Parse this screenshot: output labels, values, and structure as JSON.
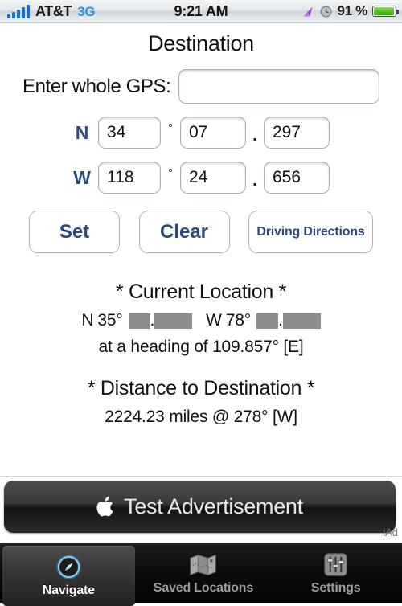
{
  "status_bar": {
    "signal_icon": "signal-bars-icon",
    "carrier": "AT&T",
    "network": "3G",
    "time": "9:21 AM",
    "location_icon": "location-arrow-icon",
    "alarm_icon": "clock-icon",
    "battery_percent": "91 %",
    "battery_icon": "battery-icon",
    "battery_level": 91,
    "accent_blue": "#2e90e8",
    "battery_green": "#51c01c",
    "location_purple": "#a13fd6"
  },
  "main": {
    "title": "Destination",
    "whole_gps": {
      "label": "Enter whole GPS:",
      "value": "",
      "placeholder": ""
    },
    "coordinates": [
      {
        "hemisphere": "N",
        "degrees": "34",
        "degree_symbol": "°",
        "minutes": "07",
        "decimal_point": ".",
        "fraction": "297"
      },
      {
        "hemisphere": "W",
        "degrees": "118",
        "degree_symbol": "°",
        "minutes": "24",
        "decimal_point": ".",
        "fraction": "656"
      }
    ],
    "buttons": {
      "set": "Set",
      "clear": "Clear",
      "driving_directions": "Driving Directions"
    },
    "label_navy": "#2d4a7c",
    "current_location": {
      "heading": "* Current Location *",
      "lat_hemisphere": "N",
      "lat_degrees": "35°",
      "lat_redacted_minutes": "redacted",
      "lat_decimal_point": ".",
      "lat_redacted_fraction": "redacted",
      "lon_hemisphere": "W",
      "lon_degrees": "78°",
      "lon_redacted_minutes": "redacted",
      "lon_decimal_point": ".",
      "lon_redacted_fraction": "redacted",
      "heading_line": "at a heading of 109.857° [E]",
      "redaction_color": "#8c8c8c"
    },
    "distance": {
      "heading": "* Distance to Destination *",
      "value_line": "2224.23 miles @ 278° [W]"
    }
  },
  "ad": {
    "logo_icon": "apple-logo-icon",
    "text": "Test Advertisement",
    "network_label": "iAd"
  },
  "tab_bar": {
    "tabs": [
      {
        "label": "Navigate",
        "icon": "compass-icon",
        "selected": true
      },
      {
        "label": "Saved Locations",
        "icon": "folded-map-icon",
        "selected": false
      },
      {
        "label": "Settings",
        "icon": "sliders-icon",
        "selected": false
      }
    ]
  }
}
